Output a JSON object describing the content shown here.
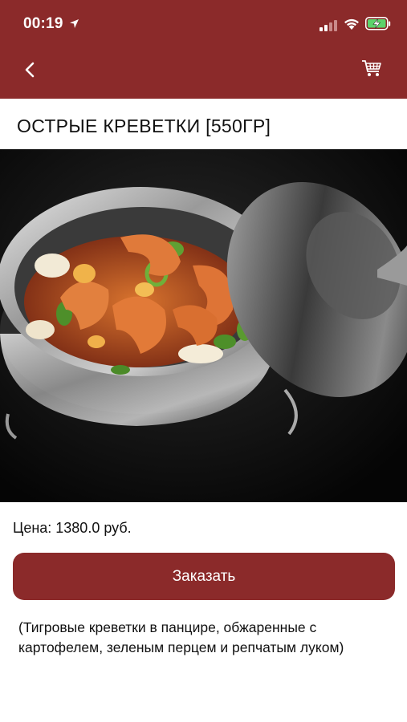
{
  "status_bar": {
    "time": "00:19",
    "icons": [
      "location-arrow-icon",
      "cellular-signal-icon",
      "wifi-icon",
      "battery-charging-icon"
    ]
  },
  "nav": {
    "back_icon": "chevron-left-icon",
    "cart_icon": "shopping-cart-icon",
    "background_color": "#8b2a2a"
  },
  "product": {
    "title": "ОСТРЫЕ КРЕВЕТКИ [550ГР]",
    "price": "Цена: 1380.0 руб.",
    "order_label": "Заказать",
    "description": "(Тигровые креветки в панцире, обжаренные с картофелем, зеленым перцем и репчатым луком)"
  },
  "colors": {
    "accent": "#8b2a2a",
    "text": "#111111",
    "background": "#ffffff"
  }
}
